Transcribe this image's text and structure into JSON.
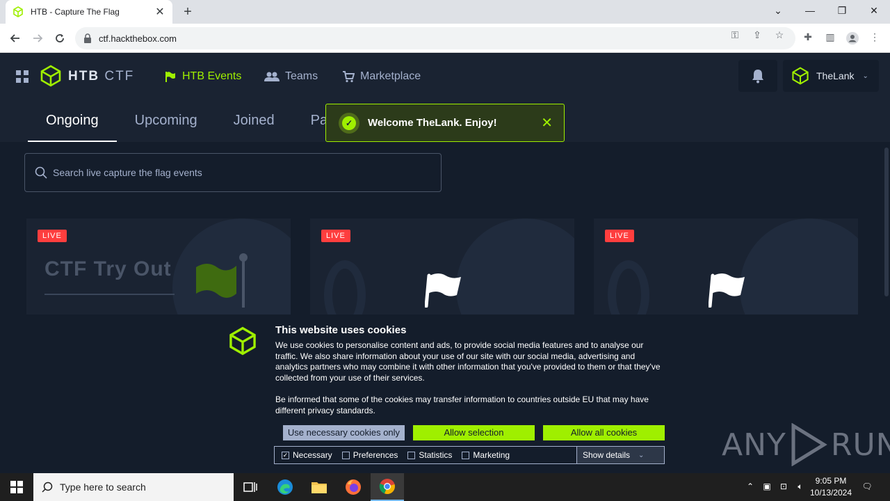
{
  "browser": {
    "tab_title": "HTB - Capture The Flag",
    "url": "ctf.hackthebox.com"
  },
  "header": {
    "logo_main": "HTB",
    "logo_sub": "CTF",
    "nav": [
      {
        "label": "HTB Events",
        "icon": "flag-icon",
        "active": true
      },
      {
        "label": "Teams",
        "icon": "people-icon"
      },
      {
        "label": "Marketplace",
        "icon": "cart-icon"
      }
    ],
    "username": "TheLank"
  },
  "tabs": [
    "Ongoing",
    "Upcoming",
    "Joined",
    "Past"
  ],
  "toast": {
    "message": "Welcome TheLank. Enjoy!"
  },
  "search": {
    "placeholder": "Search live capture the flag events"
  },
  "cards": [
    {
      "badge": "LIVE",
      "title": "CTF Try Out"
    },
    {
      "badge": "LIVE"
    },
    {
      "badge": "LIVE"
    }
  ],
  "cookies": {
    "title": "This website uses cookies",
    "body1": "We use cookies to personalise content and ads, to provide social media features and to analyse our traffic. We also share information about your use of our site with our social media, advertising and analytics partners who may combine it with other information that you've provided to them or that they've collected from your use of their services.",
    "body2": "Be informed that some of the cookies may transfer information to countries outside EU that may have different privacy standards.",
    "btn_necessary": "Use necessary cookies only",
    "btn_selection": "Allow selection",
    "btn_all": "Allow all cookies",
    "prefs": [
      "Necessary",
      "Preferences",
      "Statistics",
      "Marketing"
    ],
    "show_details": "Show details"
  },
  "watermark": {
    "left": "ANY",
    "right": "RUN"
  },
  "taskbar": {
    "search_placeholder": "Type here to search",
    "time": "9:05 PM",
    "date": "10/13/2024"
  },
  "colors": {
    "accent": "#9fef00",
    "live": "#ff3e3e",
    "bg": "#141d2b",
    "panel": "#1a2332"
  }
}
